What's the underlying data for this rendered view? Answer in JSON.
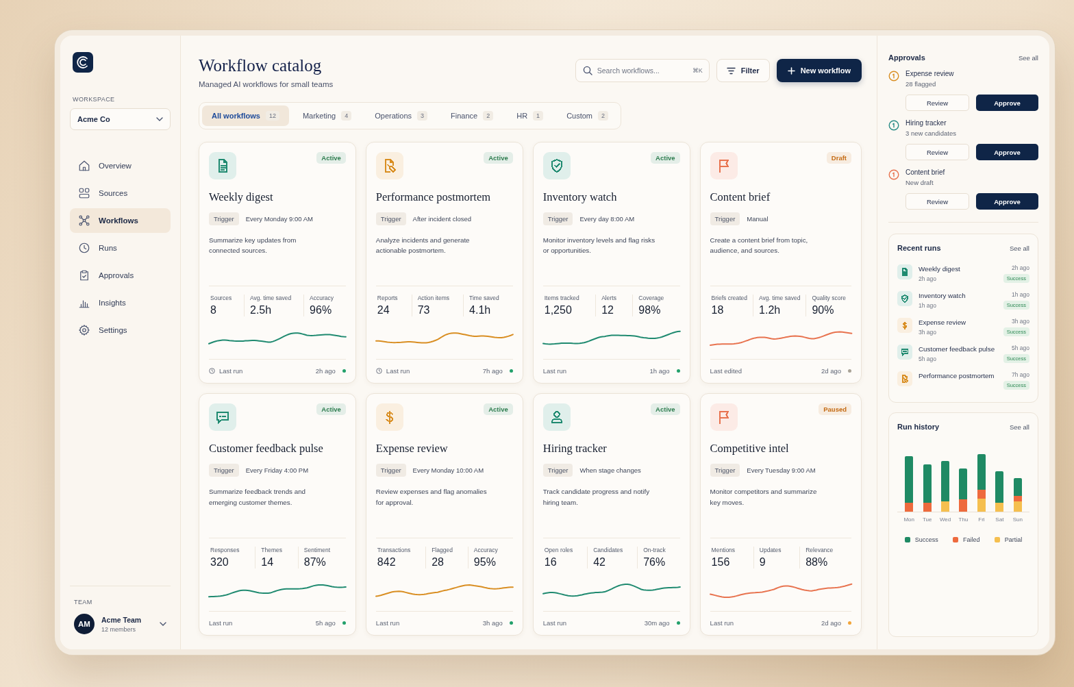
{
  "sidebar": {
    "workspace_label": "WORKSPACE",
    "workspace": "Acme Co",
    "nav": [
      {
        "label": "Overview",
        "selected": false
      },
      {
        "label": "Sources",
        "selected": false
      },
      {
        "label": "Workflows",
        "selected": true
      },
      {
        "label": "Runs",
        "selected": false
      },
      {
        "label": "Approvals",
        "selected": false
      },
      {
        "label": "Insights",
        "selected": false
      },
      {
        "label": "Settings",
        "selected": false
      }
    ],
    "team_label": "TEAM",
    "team": {
      "initials": "AM",
      "name": "Acme Team",
      "members": "12 members"
    }
  },
  "header": {
    "title": "Workflow catalog",
    "subtitle": "Managed AI workflows for small teams",
    "search": {
      "placeholder": "Search workflows...",
      "shortcut": "⌘K"
    },
    "filter_button": "Filter",
    "new_button": "New workflow"
  },
  "tabs": [
    {
      "label": "All workflows",
      "count": "12",
      "selected": true
    },
    {
      "label": "Marketing",
      "count": "4",
      "selected": false
    },
    {
      "label": "Operations",
      "count": "3",
      "selected": false
    },
    {
      "label": "Finance",
      "count": "2",
      "selected": false
    },
    {
      "label": "HR",
      "count": "1",
      "selected": false
    },
    {
      "label": "Custom",
      "count": "2",
      "selected": false
    }
  ],
  "workflows": [
    {
      "title": "Weekly digest",
      "color": "#1f8a70",
      "status": {
        "label": "Active",
        "color": "#2e7d4f"
      },
      "trigger_label": "Trigger",
      "trigger": "Every Monday 9:00 AM",
      "description": "Summarize key updates from connected sources.",
      "stats": [
        {
          "label": "Sources",
          "value": "8"
        },
        {
          "label": "Avg. time saved",
          "value": "2.5h"
        },
        {
          "label": "Accuracy",
          "value": "96%"
        }
      ],
      "last_run": {
        "label": "Last run",
        "time": "2h ago",
        "clock_icon": true,
        "color": "#22a06b"
      }
    },
    {
      "title": "Performance postmortem",
      "color": "#d98e22",
      "status": {
        "label": "Active",
        "color": "#2e7d4f"
      },
      "trigger_label": "Trigger",
      "trigger": "After incident closed",
      "description": "Analyze incidents and generate actionable postmortem.",
      "stats": [
        {
          "label": "Reports",
          "value": "24"
        },
        {
          "label": "Action items",
          "value": "73"
        },
        {
          "label": "Time saved",
          "value": "4.1h"
        }
      ],
      "last_run": {
        "label": "Last run",
        "time": "7h ago",
        "clock_icon": true,
        "color": "#22a06b"
      }
    },
    {
      "title": "Inventory watch",
      "color": "#1f8a70",
      "status": {
        "label": "Active",
        "color": "#2e7d4f"
      },
      "trigger_label": "Trigger",
      "trigger": "Every day 8:00 AM",
      "description": "Monitor inventory levels and flag risks or opportunities.",
      "stats": [
        {
          "label": "Items tracked",
          "value": "1,250"
        },
        {
          "label": "Alerts",
          "value": "12"
        },
        {
          "label": "Coverage",
          "value": "98%"
        }
      ],
      "last_run": {
        "label": "Last run",
        "time": "1h ago",
        "clock_icon": false,
        "color": "#22a06b"
      }
    },
    {
      "title": "Content brief",
      "color": "#e8734f",
      "status": {
        "label": "Draft",
        "color": "#c46a12"
      },
      "trigger_label": "Trigger",
      "trigger": "Manual",
      "description": "Create a content brief from topic, audience, and sources.",
      "stats": [
        {
          "label": "Briefs created",
          "value": "18"
        },
        {
          "label": "Avg. time saved",
          "value": "1.2h"
        },
        {
          "label": "Quality score",
          "value": "90%"
        }
      ],
      "last_run": {
        "label": "Last edited",
        "time": "2d ago",
        "clock_icon": false,
        "color": "#a9a397"
      }
    },
    {
      "title": "Customer feedback pulse",
      "color": "#1f8a70",
      "status": {
        "label": "Active",
        "color": "#2e7d4f"
      },
      "trigger_label": "Trigger",
      "trigger": "Every Friday 4:00 PM",
      "description": "Summarize feedback trends and emerging customer themes.",
      "stats": [
        {
          "label": "Responses",
          "value": "320"
        },
        {
          "label": "Themes",
          "value": "14"
        },
        {
          "label": "Sentiment",
          "value": "87%"
        }
      ],
      "last_run": {
        "label": "Last run",
        "time": "5h ago",
        "clock_icon": false,
        "color": "#22a06b"
      }
    },
    {
      "title": "Expense review",
      "color": "#d98e22",
      "status": {
        "label": "Active",
        "color": "#2e7d4f"
      },
      "trigger_label": "Trigger",
      "trigger": "Every Monday 10:00 AM",
      "description": "Review expenses and flag anomalies for approval.",
      "stats": [
        {
          "label": "Transactions",
          "value": "842"
        },
        {
          "label": "Flagged",
          "value": "28"
        },
        {
          "label": "Accuracy",
          "value": "95%"
        }
      ],
      "last_run": {
        "label": "Last run",
        "time": "3h ago",
        "clock_icon": false,
        "color": "#22a06b"
      }
    },
    {
      "title": "Hiring tracker",
      "color": "#1f8a70",
      "status": {
        "label": "Active",
        "color": "#2e7d4f"
      },
      "trigger_label": "Trigger",
      "trigger": "When stage changes",
      "description": "Track candidate progress and notify hiring team.",
      "stats": [
        {
          "label": "Open roles",
          "value": "16"
        },
        {
          "label": "Candidates",
          "value": "42"
        },
        {
          "label": "On-track",
          "value": "76%"
        }
      ],
      "last_run": {
        "label": "Last run",
        "time": "30m ago",
        "clock_icon": false,
        "color": "#22a06b"
      }
    },
    {
      "title": "Competitive intel",
      "color": "#e8734f",
      "status": {
        "label": "Paused",
        "color": "#c46a12"
      },
      "trigger_label": "Trigger",
      "trigger": "Every Tuesday 9:00 AM",
      "description": "Monitor competitors and summarize key moves.",
      "stats": [
        {
          "label": "Mentions",
          "value": "156"
        },
        {
          "label": "Updates",
          "value": "9"
        },
        {
          "label": "Relevance",
          "value": "88%"
        }
      ],
      "last_run": {
        "label": "Last run",
        "time": "2d ago",
        "clock_icon": false,
        "color": "#f2a53a"
      }
    }
  ],
  "approvals": {
    "title": "Approvals",
    "see_all": "See all",
    "items": [
      {
        "title": "Expense review",
        "detail": "28 flagged",
        "color": "#d98e22",
        "review": "Review",
        "approve": "Approve"
      },
      {
        "title": "Hiring tracker",
        "detail": "3 new candidates",
        "color": "#2a8c86",
        "review": "Review",
        "approve": "Approve"
      },
      {
        "title": "Content brief",
        "detail": "New draft",
        "color": "#e8734f",
        "review": "Review",
        "approve": "Approve"
      }
    ]
  },
  "recent_runs": {
    "title": "Recent runs",
    "see_all": "See all",
    "items": [
      {
        "title": "Weekly digest",
        "subtitle": "2h ago",
        "time": "2h ago",
        "status": "Success",
        "color": "#1f8a70"
      },
      {
        "title": "Inventory watch",
        "subtitle": "1h ago",
        "time": "1h ago",
        "status": "Success",
        "color": "#1f8a70"
      },
      {
        "title": "Expense review",
        "subtitle": "3h ago",
        "time": "3h ago",
        "status": "Success",
        "color": "#d98e22"
      },
      {
        "title": "Customer feedback pulse",
        "subtitle": "5h ago",
        "time": "5h ago",
        "status": "Success",
        "color": "#1f8a70"
      },
      {
        "title": "Performance postmortem",
        "time": "7h ago",
        "status": "Success",
        "color": "#d98e22"
      }
    ]
  },
  "run_history": {
    "title": "Run history",
    "see_all": "See all",
    "days": [
      "Mon",
      "Tue",
      "Wed",
      "Thu",
      "Fri",
      "Sat",
      "Sun"
    ],
    "legend": [
      {
        "label": "Success",
        "color": "#1f8a64"
      },
      {
        "label": "Failed",
        "color": "#ee6a3d"
      },
      {
        "label": "Partial",
        "color": "#f5bf4f"
      }
    ]
  }
}
